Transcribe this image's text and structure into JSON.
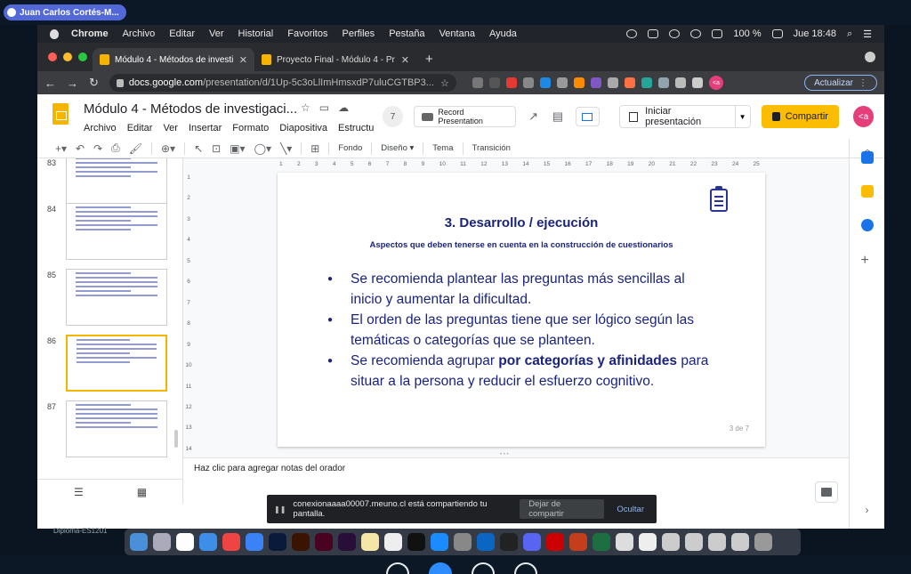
{
  "zoom": {
    "participant_name": "Juan Carlos Cortés-M..."
  },
  "mac_menubar": {
    "items": [
      "Chrome",
      "Archivo",
      "Editar",
      "Ver",
      "Historial",
      "Favoritos",
      "Perfiles",
      "Pestaña",
      "Ventana",
      "Ayuda"
    ],
    "battery": "100 %",
    "clock": "Jue 18:48"
  },
  "browser": {
    "tabs": [
      {
        "label": "Módulo 4 - Métodos de investi",
        "active": true
      },
      {
        "label": "Proyecto Final - Módulo 4 - Pr",
        "active": false
      }
    ],
    "url_domain": "docs.google.com",
    "url_path": "/presentation/d/1Up-5c3oLlImHmsxdP7uluCGTBP3...",
    "update_button": "Actualizar",
    "profile_initials": "<a"
  },
  "slides_app": {
    "doc_title": "Módulo 4 - Métodos de investigaci...",
    "menu": [
      "Archivo",
      "Editar",
      "Ver",
      "Insertar",
      "Formato",
      "Diapositiva",
      "Estructu"
    ],
    "comment_count": "7",
    "record_label": "Record Presentation",
    "present_label": "Iniciar presentación",
    "share_label": "Compartir",
    "account_initials": "<a",
    "toolbar": {
      "background": "Fondo",
      "layout": "Diseño ▾",
      "theme": "Tema",
      "transition": "Transición"
    }
  },
  "filmstrip": {
    "slides": [
      {
        "number": "83",
        "selected": false
      },
      {
        "number": "84",
        "selected": false
      },
      {
        "number": "85",
        "selected": false
      },
      {
        "number": "86",
        "selected": true
      },
      {
        "number": "87",
        "selected": false
      }
    ]
  },
  "slide": {
    "title": "3. Desarrollo / ejecución",
    "subtitle": "Aspectos que deben tenerse en cuenta en la construcción de cuestionarios",
    "bullet1": "Se recomienda plantear las preguntas más sencillas al inicio y aumentar la dificultad.",
    "bullet2": "El orden de las preguntas tiene que ser lógico según las temáticas o categorías que se planteen.",
    "bullet3_pre": "Se recomienda agrupar ",
    "bullet3_bold": "por categorías y afinidades",
    "bullet3_post": " para situar a la persona y reducir el esfuerzo cognitivo.",
    "page": "3 de 7"
  },
  "ruler": {
    "h": [
      "1",
      "2",
      "3",
      "4",
      "5",
      "6",
      "7",
      "8",
      "9",
      "10",
      "11",
      "12",
      "13",
      "14",
      "15",
      "16",
      "17",
      "18",
      "19",
      "20",
      "21",
      "22",
      "23",
      "24",
      "25"
    ],
    "v": [
      "1",
      "2",
      "3",
      "4",
      "5",
      "6",
      "7",
      "8",
      "9",
      "10",
      "11",
      "12",
      "13",
      "14"
    ]
  },
  "notes": {
    "placeholder": "Haz clic para agregar notas del orador"
  },
  "share_banner": {
    "message": "conexionaaaa00007.meuno.cl está compartiendo tu pantalla.",
    "stop": "Dejar de compartir",
    "hide": "Ocultar"
  },
  "dock_caption": "Diploma-ES1201",
  "colors": {
    "accent": "#fbbc04",
    "slide_text": "#1a237e",
    "selection": "#f4b400"
  }
}
